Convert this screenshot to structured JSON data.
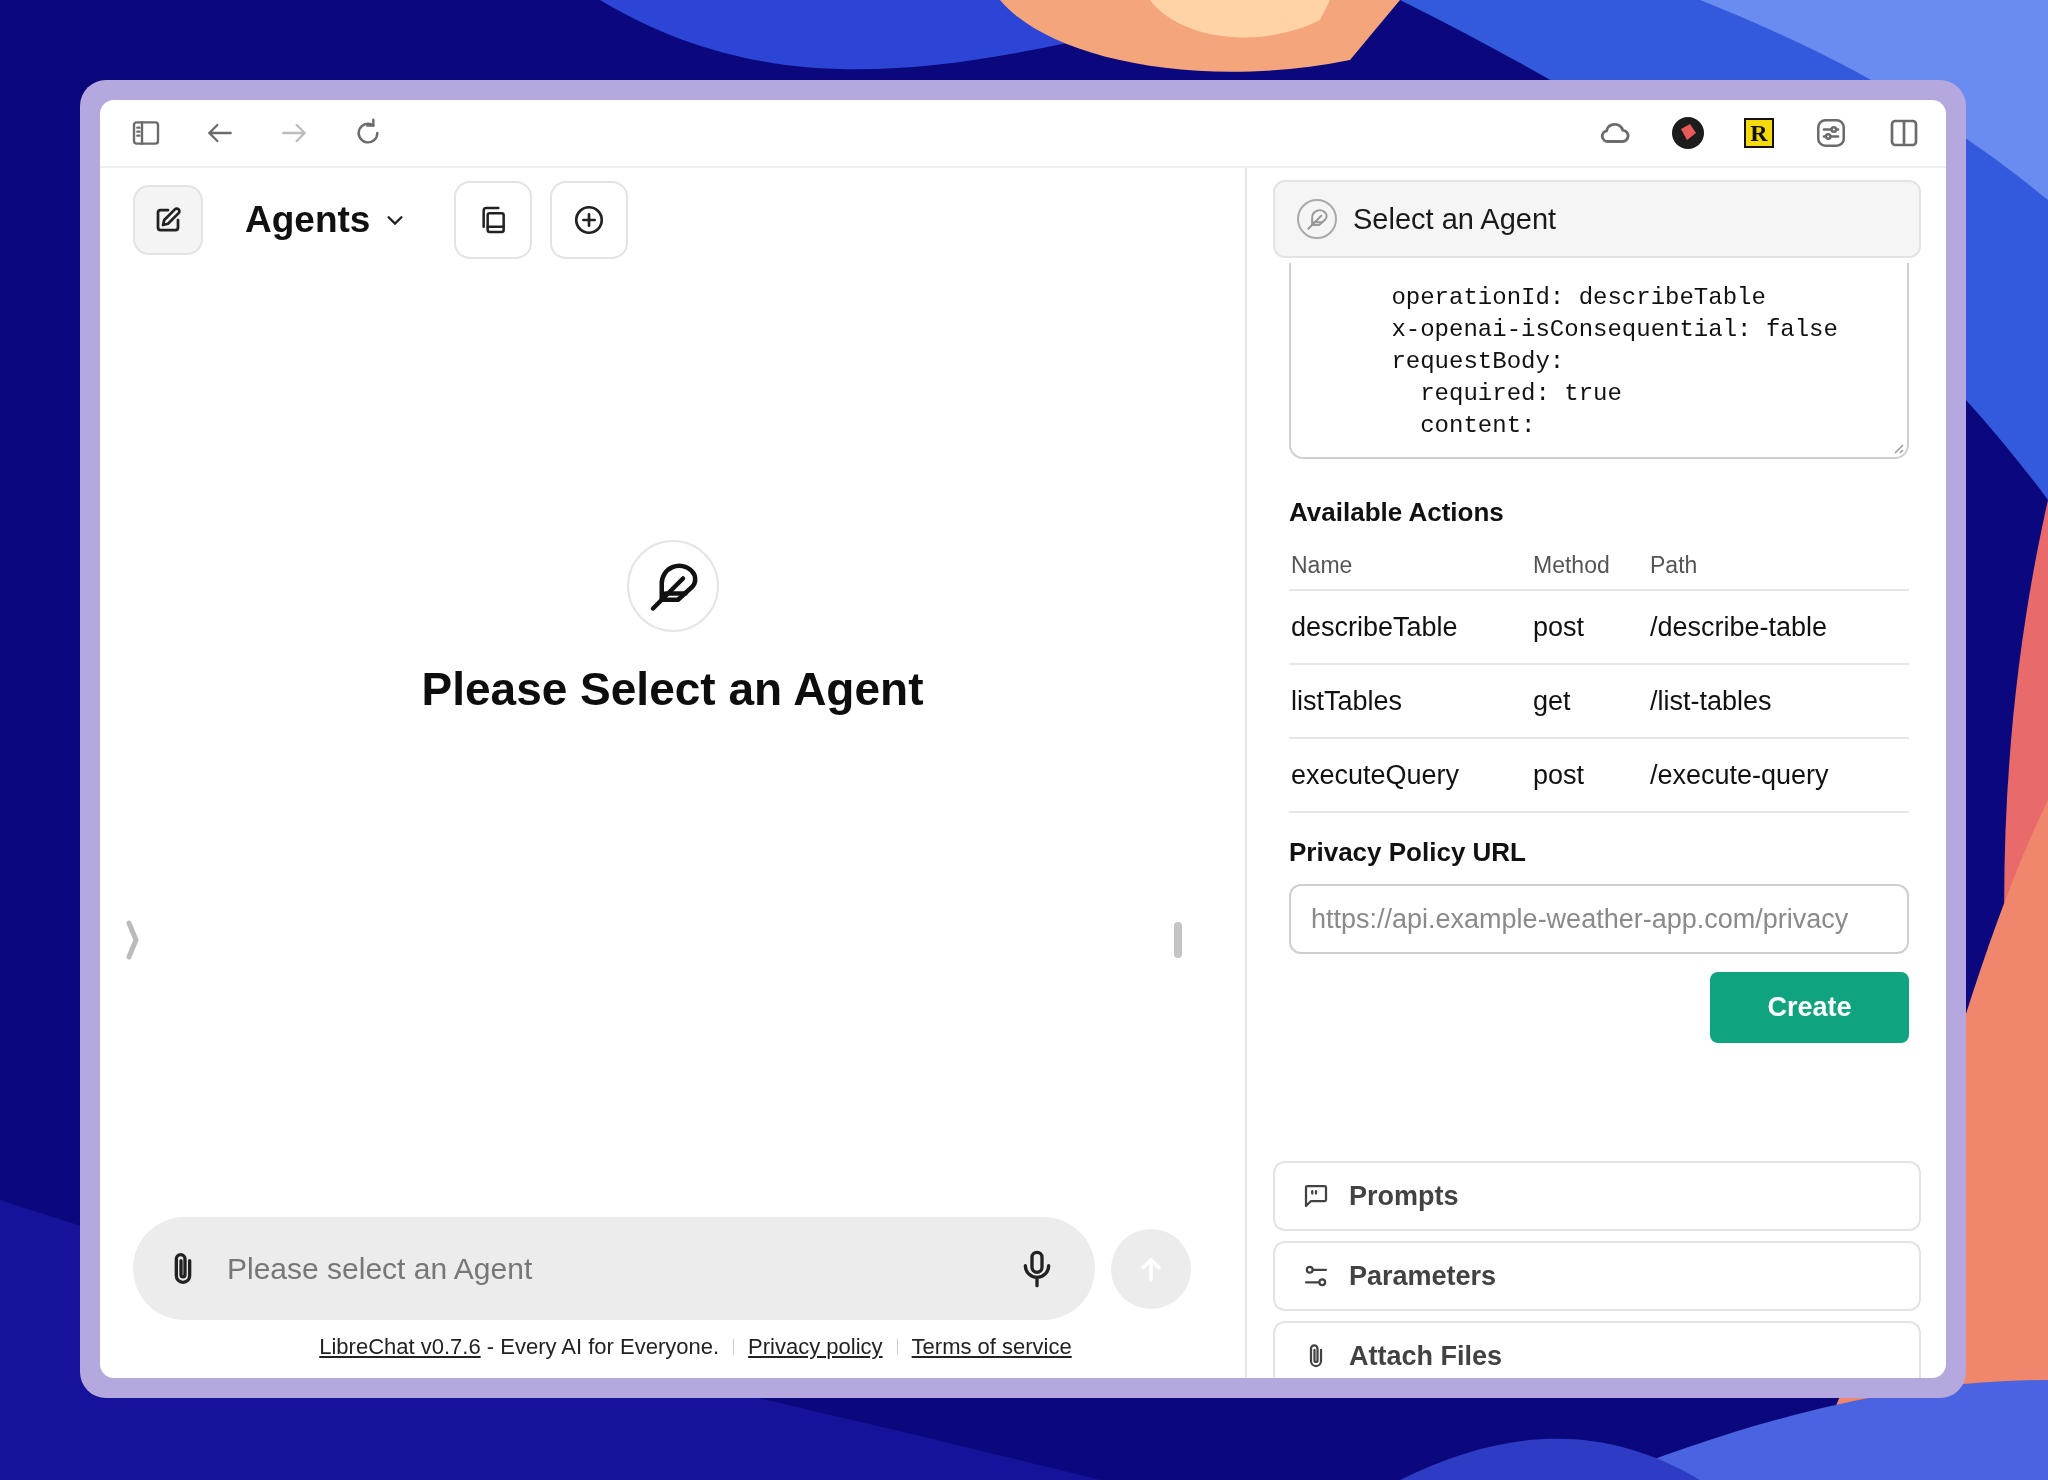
{
  "toolbar": {
    "nav": [
      {
        "kind": "sidebar",
        "disabled": false
      },
      {
        "kind": "back",
        "disabled": false
      },
      {
        "kind": "forward",
        "disabled": true
      },
      {
        "kind": "reload",
        "disabled": false
      }
    ],
    "extensions": [
      {
        "kind": "cloud"
      },
      {
        "kind": "badge"
      },
      {
        "kind": "letter",
        "label": "R"
      },
      {
        "kind": "sliders"
      },
      {
        "kind": "split"
      }
    ]
  },
  "chat": {
    "header": {
      "title": "Agents"
    },
    "empty_state": {
      "title": "Please Select an Agent"
    },
    "input": {
      "placeholder": "Please select an Agent"
    },
    "footer": {
      "brand_link": "LibreChat v0.7.6",
      "tagline": " - Every AI for Everyone.",
      "links": [
        "Privacy policy",
        "Terms of service"
      ]
    }
  },
  "panel": {
    "agent_select": {
      "label": "Select an Agent"
    },
    "schema_lines": [
      "      operationId: describeTable",
      "      x-openai-isConsequential: false",
      "      requestBody:",
      "        required: true",
      "        content:"
    ],
    "actions": {
      "title": "Available Actions",
      "columns": [
        "Name",
        "Method",
        "Path"
      ],
      "rows": [
        [
          "describeTable",
          "post",
          "/describe-table"
        ],
        [
          "listTables",
          "get",
          "/list-tables"
        ],
        [
          "executeQuery",
          "post",
          "/execute-query"
        ]
      ]
    },
    "privacy": {
      "label": "Privacy Policy URL",
      "placeholder": "https://api.example-weather-app.com/privacy"
    },
    "create_button": "Create",
    "sections": [
      {
        "kind": "prompts",
        "label": "Prompts"
      },
      {
        "kind": "parameters",
        "label": "Parameters"
      },
      {
        "kind": "files",
        "label": "Attach Files"
      }
    ]
  }
}
